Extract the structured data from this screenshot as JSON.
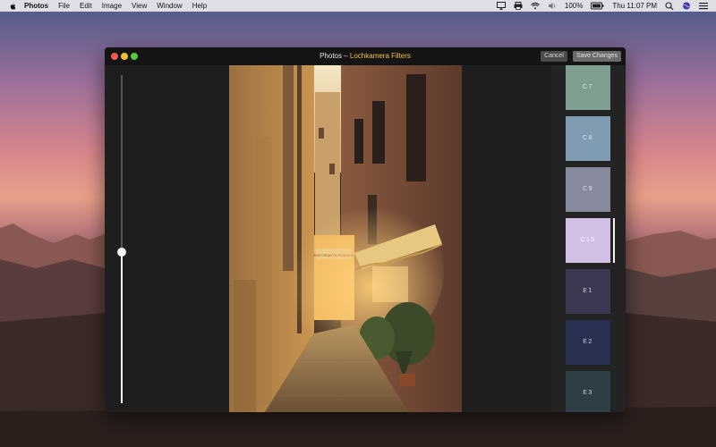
{
  "menubar": {
    "app_name": "Photos",
    "items": [
      "File",
      "Edit",
      "Image",
      "View",
      "Window",
      "Help"
    ],
    "battery": "100%",
    "clock": "Thu 11:07 PM",
    "icons": [
      "apple-icon",
      "airplay-icon",
      "printer-icon",
      "wifi-icon",
      "volume-icon",
      "battery-icon",
      "search-icon",
      "siri-icon",
      "list-icon"
    ]
  },
  "window": {
    "title_prefix": "Photos – ",
    "title_extension": "Lochkamera Filters",
    "cancel_label": "Cancel",
    "save_label": "Save Changes",
    "colors": {
      "accent": "#f5c340",
      "background": "#1e1e1e",
      "titlebar": "#141414"
    }
  },
  "slider": {
    "value": 0.46
  },
  "filters": {
    "items": [
      {
        "label": "C7",
        "color": "#7e9e8f"
      },
      {
        "label": "C8",
        "color": "#7f9cb3"
      },
      {
        "label": "C9",
        "color": "#868a9c"
      },
      {
        "label": "C10",
        "color": "#d2bfe4",
        "selected": true
      },
      {
        "label": "E1",
        "color": "#3d3752"
      },
      {
        "label": "E2",
        "color": "#283152"
      },
      {
        "label": "E3",
        "color": "#2d3f44"
      }
    ]
  },
  "photo": {
    "sign_text": "RISTORANTE PIZZERIA"
  }
}
